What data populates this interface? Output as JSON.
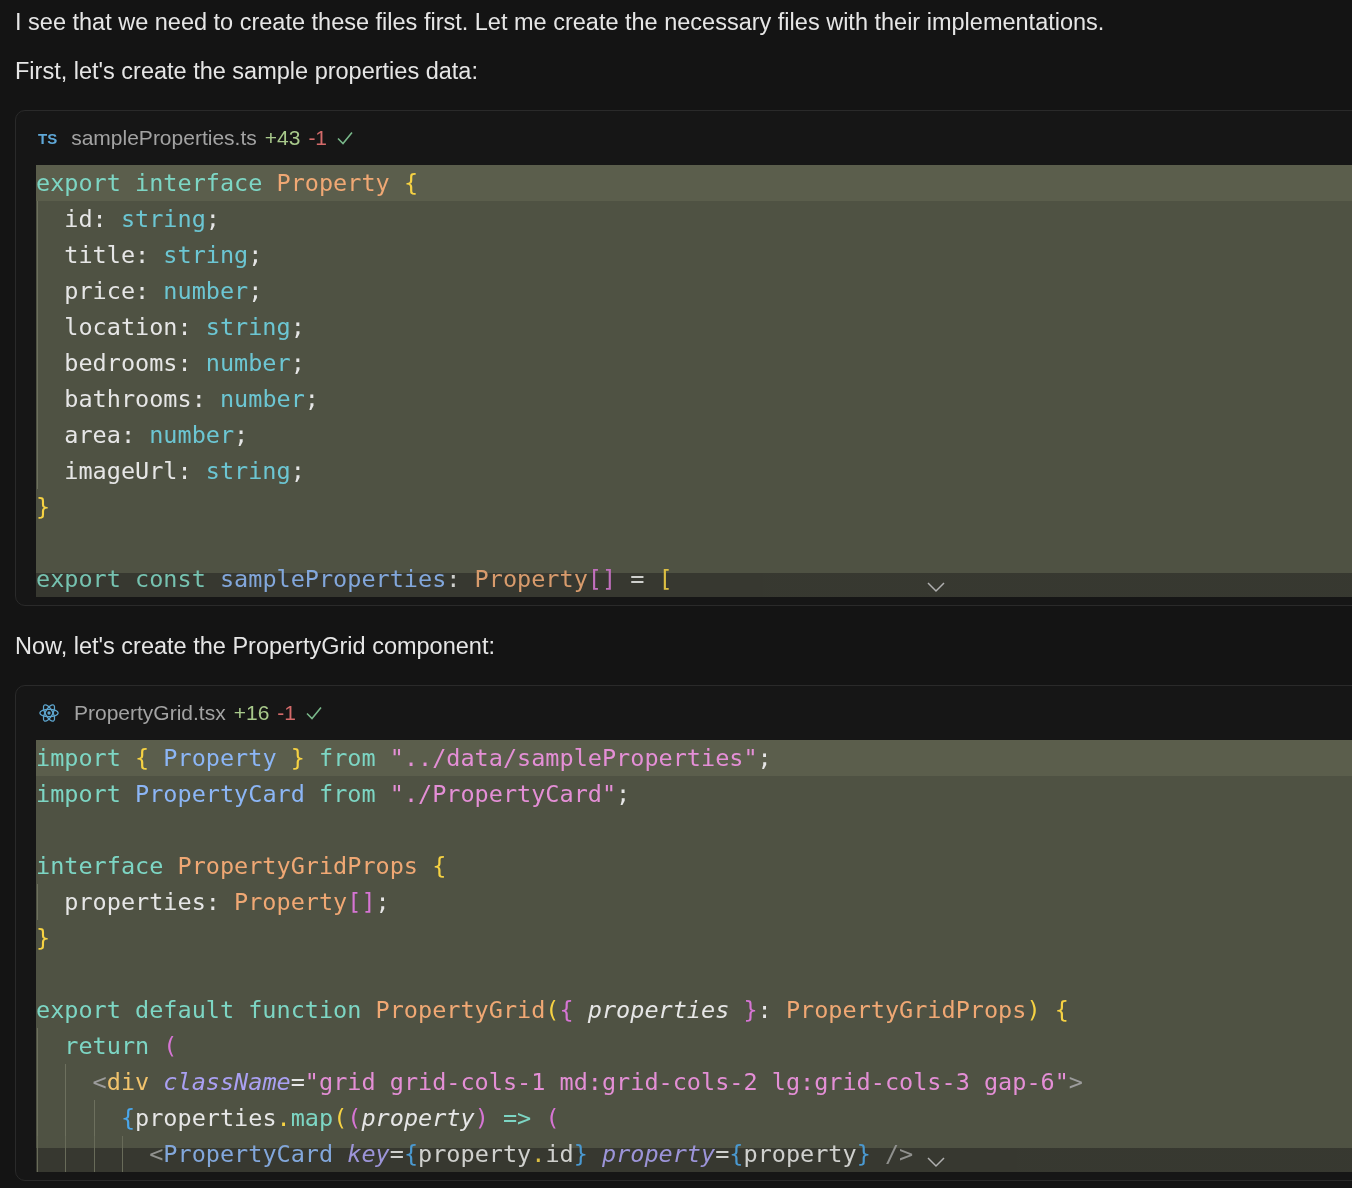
{
  "blocks": [
    {
      "kind": "text",
      "text": "I see that we need to create these files first. Let me create the necessary files with their implementations."
    },
    {
      "kind": "text",
      "text": "First, let's create the sample properties data:"
    },
    {
      "kind": "code",
      "file": {
        "icon": {
          "kind": "ts",
          "text": "TS"
        },
        "name": "sampleProperties.ts",
        "added": "+43",
        "removed": "-1",
        "applied": true
      },
      "lines": [
        {
          "kind": "code",
          "highlighted": true,
          "tokens": [
            {
              "kind": "keyword",
              "text": "export interface "
            },
            {
              "kind": "type",
              "text": "Property "
            },
            {
              "kind": "b1",
              "text": "{"
            }
          ]
        },
        {
          "kind": "code",
          "highlighted": false,
          "tokens": [
            {
              "kind": "plain",
              "text": "  id: "
            },
            {
              "kind": "builtin",
              "text": "string"
            },
            {
              "kind": "plain",
              "text": ";"
            }
          ]
        },
        {
          "kind": "code",
          "highlighted": false,
          "tokens": [
            {
              "kind": "plain",
              "text": "  title: "
            },
            {
              "kind": "builtin",
              "text": "string"
            },
            {
              "kind": "plain",
              "text": ";"
            }
          ]
        },
        {
          "kind": "code",
          "highlighted": false,
          "tokens": [
            {
              "kind": "plain",
              "text": "  price: "
            },
            {
              "kind": "builtin",
              "text": "number"
            },
            {
              "kind": "plain",
              "text": ";"
            }
          ]
        },
        {
          "kind": "code",
          "highlighted": false,
          "tokens": [
            {
              "kind": "plain",
              "text": "  location: "
            },
            {
              "kind": "builtin",
              "text": "string"
            },
            {
              "kind": "plain",
              "text": ";"
            }
          ]
        },
        {
          "kind": "code",
          "highlighted": false,
          "tokens": [
            {
              "kind": "plain",
              "text": "  bedrooms: "
            },
            {
              "kind": "builtin",
              "text": "number"
            },
            {
              "kind": "plain",
              "text": ";"
            }
          ]
        },
        {
          "kind": "code",
          "highlighted": false,
          "tokens": [
            {
              "kind": "plain",
              "text": "  bathrooms: "
            },
            {
              "kind": "builtin",
              "text": "number"
            },
            {
              "kind": "plain",
              "text": ";"
            }
          ]
        },
        {
          "kind": "code",
          "highlighted": false,
          "tokens": [
            {
              "kind": "plain",
              "text": "  area: "
            },
            {
              "kind": "builtin",
              "text": "number"
            },
            {
              "kind": "plain",
              "text": ";"
            }
          ]
        },
        {
          "kind": "code",
          "highlighted": false,
          "tokens": [
            {
              "kind": "plain",
              "text": "  imageUrl: "
            },
            {
              "kind": "builtin",
              "text": "string"
            },
            {
              "kind": "plain",
              "text": ";"
            }
          ]
        },
        {
          "kind": "code",
          "highlighted": false,
          "tokens": [
            {
              "kind": "b1",
              "text": "}"
            }
          ]
        },
        {
          "kind": "blank"
        },
        {
          "kind": "code",
          "highlighted": false,
          "tokens": [
            {
              "kind": "keyword",
              "text": "export const "
            },
            {
              "kind": "ident",
              "text": "sampleProperties"
            },
            {
              "kind": "plain",
              "text": ": "
            },
            {
              "kind": "type",
              "text": "Property"
            },
            {
              "kind": "b2",
              "text": "[]"
            },
            {
              "kind": "plain",
              "text": " = "
            },
            {
              "kind": "b1",
              "text": "["
            }
          ]
        }
      ]
    },
    {
      "kind": "text",
      "text": "Now, let's create the PropertyGrid component:"
    },
    {
      "kind": "code",
      "file": {
        "icon": {
          "kind": "react"
        },
        "name": "PropertyGrid.tsx",
        "added": "+16",
        "removed": "-1",
        "applied": true
      },
      "lines": [
        {
          "kind": "code",
          "highlighted": true,
          "tokens": [
            {
              "kind": "keyword",
              "text": "import "
            },
            {
              "kind": "b1",
              "text": "{ "
            },
            {
              "kind": "ident",
              "text": "Property "
            },
            {
              "kind": "b1",
              "text": "} "
            },
            {
              "kind": "keyword",
              "text": "from "
            },
            {
              "kind": "string",
              "text": "\"../data/sampleProperties\""
            },
            {
              "kind": "plain",
              "text": ";"
            }
          ]
        },
        {
          "kind": "code",
          "highlighted": false,
          "tokens": [
            {
              "kind": "keyword",
              "text": "import "
            },
            {
              "kind": "ident",
              "text": "PropertyCard "
            },
            {
              "kind": "keyword",
              "text": "from "
            },
            {
              "kind": "string",
              "text": "\"./PropertyCard\""
            },
            {
              "kind": "plain",
              "text": ";"
            }
          ]
        },
        {
          "kind": "blank"
        },
        {
          "kind": "code",
          "highlighted": false,
          "tokens": [
            {
              "kind": "keyword",
              "text": "interface "
            },
            {
              "kind": "type",
              "text": "PropertyGridProps "
            },
            {
              "kind": "b1",
              "text": "{"
            }
          ]
        },
        {
          "kind": "code",
          "highlighted": false,
          "tokens": [
            {
              "kind": "plain",
              "text": "  properties: "
            },
            {
              "kind": "type",
              "text": "Property"
            },
            {
              "kind": "b2",
              "text": "[]"
            },
            {
              "kind": "plain",
              "text": ";"
            }
          ]
        },
        {
          "kind": "code",
          "highlighted": false,
          "tokens": [
            {
              "kind": "b1",
              "text": "}"
            }
          ]
        },
        {
          "kind": "blank"
        },
        {
          "kind": "code",
          "highlighted": false,
          "tokens": [
            {
              "kind": "keyword",
              "text": "export default function "
            },
            {
              "kind": "type",
              "text": "PropertyGrid"
            },
            {
              "kind": "b1",
              "text": "("
            },
            {
              "kind": "b2",
              "text": "{ "
            },
            {
              "kind": "param",
              "text": "properties "
            },
            {
              "kind": "b2",
              "text": "}"
            },
            {
              "kind": "plain",
              "text": ": "
            },
            {
              "kind": "type",
              "text": "PropertyGridProps"
            },
            {
              "kind": "b1",
              "text": ") {"
            }
          ]
        },
        {
          "kind": "code",
          "highlighted": false,
          "tokens": [
            {
              "kind": "keyword",
              "text": "  return "
            },
            {
              "kind": "b2",
              "text": "("
            }
          ]
        },
        {
          "kind": "code",
          "highlighted": false,
          "tokens": [
            {
              "kind": "punct",
              "text": "    <"
            },
            {
              "kind": "tag",
              "text": "div "
            },
            {
              "kind": "attr",
              "text": "className"
            },
            {
              "kind": "plain",
              "text": "="
            },
            {
              "kind": "string",
              "text": "\"grid grid-cols-1 md:grid-cols-2 lg:grid-cols-3 gap-6\""
            },
            {
              "kind": "punct",
              "text": ">"
            }
          ]
        },
        {
          "kind": "code",
          "highlighted": false,
          "tokens": [
            {
              "kind": "b3",
              "text": "      {"
            },
            {
              "kind": "plain",
              "text": "properties"
            },
            {
              "kind": "b1",
              "text": "."
            },
            {
              "kind": "keyword",
              "text": "map"
            },
            {
              "kind": "b1",
              "text": "("
            },
            {
              "kind": "b2",
              "text": "("
            },
            {
              "kind": "param",
              "text": "property"
            },
            {
              "kind": "b2",
              "text": ") "
            },
            {
              "kind": "keyword",
              "text": "=> "
            },
            {
              "kind": "b2",
              "text": "("
            }
          ]
        },
        {
          "kind": "code",
          "highlighted": false,
          "tokens": [
            {
              "kind": "punct",
              "text": "        <"
            },
            {
              "kind": "ident",
              "text": "PropertyCard "
            },
            {
              "kind": "attr",
              "text": "key"
            },
            {
              "kind": "plain",
              "text": "="
            },
            {
              "kind": "b3",
              "text": "{"
            },
            {
              "kind": "plain",
              "text": "property"
            },
            {
              "kind": "b1",
              "text": "."
            },
            {
              "kind": "plain",
              "text": "id"
            },
            {
              "kind": "b3",
              "text": "} "
            },
            {
              "kind": "attr",
              "text": "property"
            },
            {
              "kind": "plain",
              "text": "="
            },
            {
              "kind": "b3",
              "text": "{"
            },
            {
              "kind": "plain",
              "text": "property"
            },
            {
              "kind": "b3",
              "text": "} "
            },
            {
              "kind": "punct",
              "text": "/>"
            }
          ]
        }
      ]
    }
  ]
}
